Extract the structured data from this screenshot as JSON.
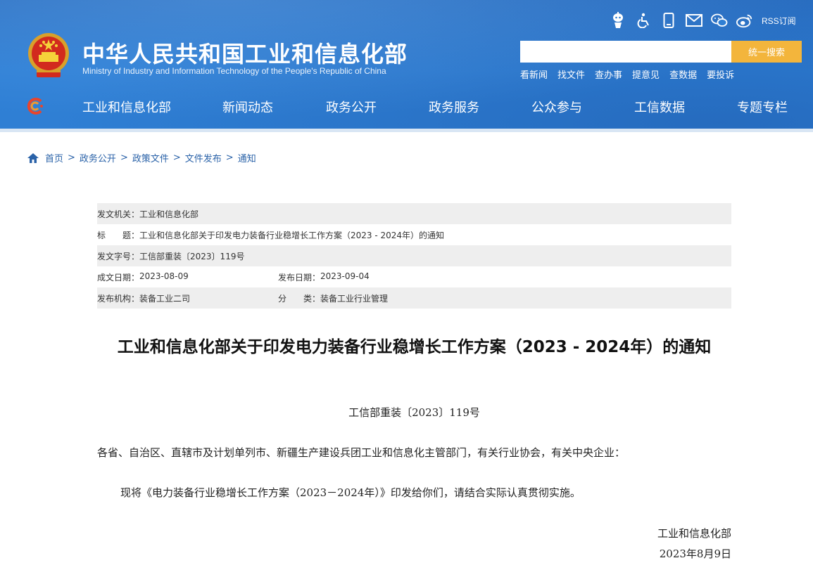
{
  "header": {
    "title": "中华人民共和国工业和信息化部",
    "subtitle": "Ministry of Industry and Information Technology of the People's Republic of China",
    "rss_label": "RSS订阅",
    "tool_icons": [
      "robot-assistant-icon",
      "accessibility-icon",
      "mobile-icon",
      "mail-icon",
      "wechat-icon",
      "weibo-icon"
    ],
    "search": {
      "placeholder": "",
      "button_label": "统一搜索"
    },
    "quick_links": [
      "看新闻",
      "找文件",
      "查办事",
      "提意见",
      "查数据",
      "要投诉"
    ],
    "nav": [
      "工业和信息化部",
      "新闻动态",
      "政务公开",
      "政务服务",
      "公众参与",
      "工信数据",
      "专题专栏"
    ],
    "colors": {
      "header_blue": "#2f7fd4",
      "search_button": "#f3b53c",
      "link_blue": "#2a62a8"
    }
  },
  "breadcrumb": [
    "首页",
    "政务公开",
    "政策文件",
    "文件发布",
    "通知"
  ],
  "meta": {
    "issuer_label": "发文机关：",
    "issuer": "工业和信息化部",
    "title_label": "标　　题：",
    "title": "工业和信息化部关于印发电力装备行业稳增长工作方案（2023 - 2024年）的通知",
    "doc_no_label": "发文字号：",
    "doc_no": "工信部重装〔2023〕119号",
    "created_label": "成文日期：",
    "created": "2023-08-09",
    "published_label": "发布日期：",
    "published": "2023-09-04",
    "org_label": "发布机构：",
    "org": "装备工业二司",
    "category_label": "分　　类：",
    "category": "装备工业行业管理"
  },
  "article": {
    "title": "工业和信息化部关于印发电力装备行业稳增长工作方案（2023 - 2024年）的通知",
    "doc_number": "工信部重装〔2023〕119号",
    "addressees": "各省、自治区、直辖市及计划单列市、新疆生产建设兵团工业和信息化主管部门，有关行业协会，有关中央企业：",
    "body": "现将《电力装备行业稳增长工作方案（2023－2024年）》印发给你们，请结合实际认真贯彻实施。",
    "signer": "工业和信息化部",
    "sign_date": "2023年8月9日"
  }
}
